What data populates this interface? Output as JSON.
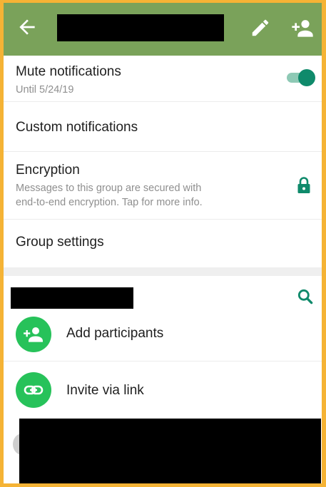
{
  "appbar": {
    "back_icon": "arrow-left-icon",
    "edit_icon": "pencil-icon",
    "add_participant_icon": "person-add-icon",
    "color": "#7aa25a"
  },
  "settings": {
    "mute": {
      "title": "Mute notifications",
      "subtitle": "Until 5/24/19",
      "toggle_on": true
    },
    "custom": {
      "title": "Custom notifications"
    },
    "encryption": {
      "title": "Encryption",
      "subtitle_line1": "Messages to this group are secured with",
      "subtitle_line2": "end-to-end encryption. Tap for more info.",
      "icon": "lock-icon"
    },
    "group_settings": {
      "title": "Group settings"
    }
  },
  "participants": {
    "search_icon": "search-icon",
    "actions": [
      {
        "label": "Add participants",
        "icon": "person-add-icon"
      },
      {
        "label": "Invite via link",
        "icon": "link-icon"
      }
    ]
  },
  "colors": {
    "accent": "#0f8a6b",
    "action_green": "#27c25a",
    "frame": "#f5b335"
  }
}
